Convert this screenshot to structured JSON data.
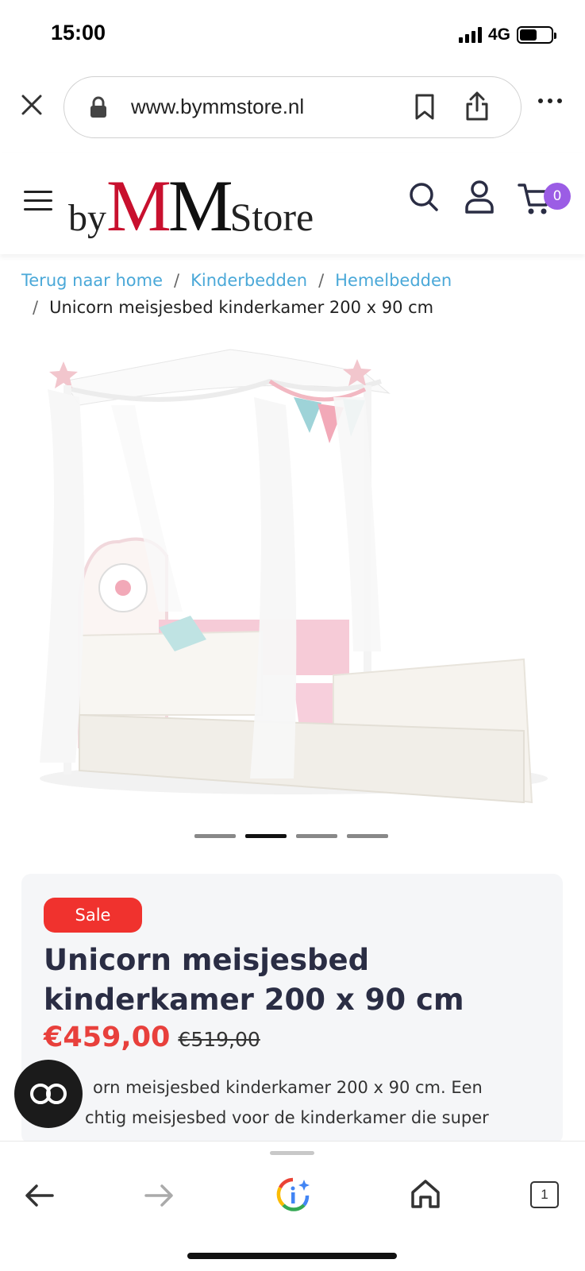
{
  "status_bar": {
    "time": "15:00",
    "network": "4G",
    "battery_level": 0.55
  },
  "browser": {
    "url": "www.bymmstore.nl",
    "icons": [
      "close-icon",
      "lock-icon",
      "bookmark-icon",
      "share-icon",
      "more-icon"
    ]
  },
  "header": {
    "logo": {
      "by": "by",
      "mm_first": "M",
      "mm_second": "M",
      "store": "Store"
    },
    "cart_count": "0",
    "icons": [
      "menu-icon",
      "search-icon",
      "user-icon",
      "cart-icon"
    ]
  },
  "breadcrumb": {
    "items": [
      "Terug naar home",
      "Kinderbedden",
      "Hemelbedden"
    ],
    "separator": "/",
    "current": "Unicorn meisjesbed kinderkamer 200 x 90 cm"
  },
  "gallery": {
    "image_count": 4,
    "active_index": 1
  },
  "product": {
    "badge": "Sale",
    "title": "Unicorn meisjesbed kinderkamer 200 x 90 cm",
    "price": "€459,00",
    "old_price": "€519,00",
    "description_line1": "orn meisjesbed kinderkamer 200 x 90 cm. Een",
    "description_line2": "chtig meisjesbed voor de kinderkamer die super"
  },
  "toolbar": {
    "tabs_count": "1",
    "icons": [
      "back-icon",
      "forward-icon",
      "google-lens-icon",
      "home-icon",
      "tabs-icon"
    ]
  },
  "colors": {
    "link": "#4aa8d8",
    "sale_badge": "#f0322e",
    "price": "#e8403c",
    "logo_red": "#c8102e",
    "cart_badge": "#9b5de5",
    "title": "#2a2d44"
  }
}
